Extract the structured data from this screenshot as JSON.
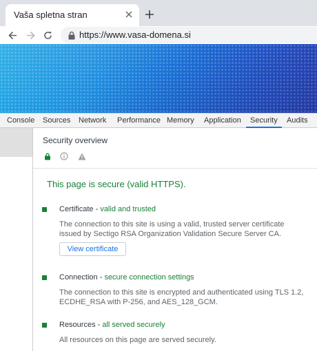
{
  "browser": {
    "tab_title": "Vaša spletna stran",
    "url": "https://www.vasa-domena.si"
  },
  "devtools": {
    "tabs": [
      "Console",
      "Sources",
      "Network",
      "Performance",
      "Memory",
      "Application",
      "Security",
      "Audits"
    ],
    "active_tab": "Security"
  },
  "security": {
    "overview_title": "Security overview",
    "summary": "This page is secure (valid HTTPS).",
    "sections": [
      {
        "label": "Certificate",
        "status": "valid and trusted",
        "description": "The connection to this site is using a valid, trusted server certificate issued by Sectigo RSA Organization Validation Secure Server CA.",
        "button": "View certificate"
      },
      {
        "label": "Connection",
        "status": "secure connection settings",
        "description": "The connection to this site is encrypted and authenticated using TLS 1.2, ECDHE_RSA with P-256, and AES_128_GCM."
      },
      {
        "label": "Resources",
        "status": "all served securely",
        "description": "All resources on this page are served securely."
      }
    ]
  },
  "colors": {
    "secure_green": "#188038",
    "accent_blue": "#1a73e8"
  },
  "icons": {
    "tab_close": "close-icon",
    "new_tab": "plus-icon",
    "back": "arrow-left-icon",
    "forward": "arrow-right-icon",
    "reload": "reload-icon",
    "secure": "lock-icon",
    "info": "info-icon",
    "warning": "warning-icon"
  }
}
